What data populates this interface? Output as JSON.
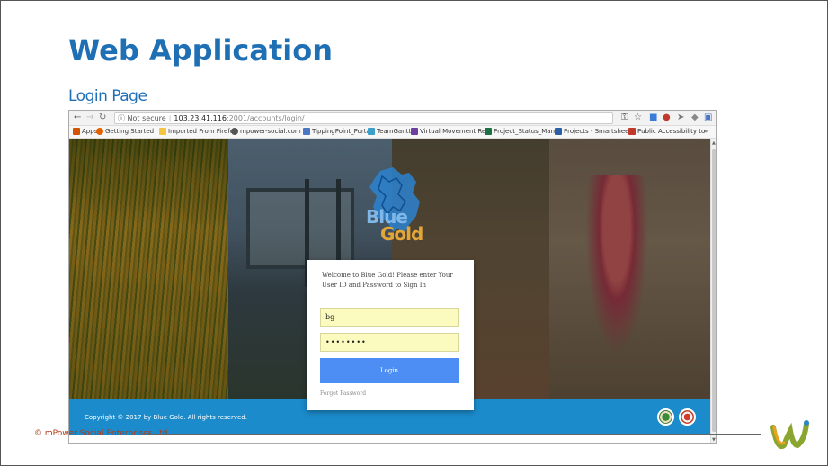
{
  "slide": {
    "title": "Web Application",
    "subtitle": "Login Page",
    "footer": "© mPower Social Enterprises Ltd."
  },
  "browser": {
    "url_security": "ⓘ Not secure",
    "url_host": "103.23.41.116",
    "url_path": ":2001/accounts/login/",
    "bookmarks": [
      {
        "label": "Apps",
        "icon": "apps-grid-icon",
        "color": "#d35400"
      },
      {
        "label": "Getting Started",
        "icon": "firefox-icon",
        "color": "#e66000"
      },
      {
        "label": "Imported From Firefo",
        "icon": "folder-icon",
        "color": "#f4c542"
      },
      {
        "label": "mpower-social.com -",
        "icon": "globe-icon",
        "color": "#555555"
      },
      {
        "label": "TippingPoint_Portal",
        "icon": "page-icon",
        "color": "#4a76c4"
      },
      {
        "label": "TeamGantt",
        "icon": "teamgantt-icon",
        "color": "#3aa0c9"
      },
      {
        "label": "Virtual Movement Re",
        "icon": "calendar-icon",
        "color": "#6b3fa0"
      },
      {
        "label": "Project_Status_Mana",
        "icon": "excel-icon",
        "color": "#1e7145"
      },
      {
        "label": "Projects - Smartshee",
        "icon": "smartsheet-icon",
        "color": "#2a5fa8"
      },
      {
        "label": "Public Accessibility to",
        "icon": "sheet-icon",
        "color": "#c0392b"
      },
      {
        "label": "»",
        "icon": "more-icon",
        "color": "#333333"
      }
    ]
  },
  "page": {
    "logo_top": "Blue",
    "logo_bottom": "Gold",
    "welcome": "Welcome to Blue Gold! Please enter Your User ID and Password to Sign In",
    "username_value": "bg",
    "password_value": "••••••••",
    "login_label": "Login",
    "forgot_label": "Forgot Password",
    "copyright": "Copyright © 2017 by Blue Gold. All rights reserved."
  },
  "colors": {
    "accent": "#1f6fb5",
    "login_button": "#4d8ef5",
    "footer_bar": "#1b8bcb",
    "field_bg": "#fbfbc0",
    "slide_footer_text": "#b13b16"
  }
}
